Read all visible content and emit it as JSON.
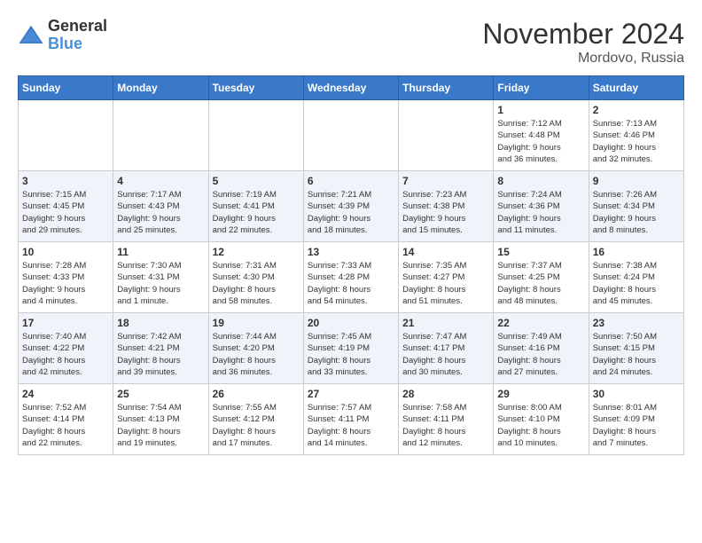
{
  "header": {
    "logo_line1": "General",
    "logo_line2": "Blue",
    "month": "November 2024",
    "location": "Mordovo, Russia"
  },
  "days_of_week": [
    "Sunday",
    "Monday",
    "Tuesday",
    "Wednesday",
    "Thursday",
    "Friday",
    "Saturday"
  ],
  "weeks": [
    [
      {
        "day": "",
        "info": ""
      },
      {
        "day": "",
        "info": ""
      },
      {
        "day": "",
        "info": ""
      },
      {
        "day": "",
        "info": ""
      },
      {
        "day": "",
        "info": ""
      },
      {
        "day": "1",
        "info": "Sunrise: 7:12 AM\nSunset: 4:48 PM\nDaylight: 9 hours\nand 36 minutes."
      },
      {
        "day": "2",
        "info": "Sunrise: 7:13 AM\nSunset: 4:46 PM\nDaylight: 9 hours\nand 32 minutes."
      }
    ],
    [
      {
        "day": "3",
        "info": "Sunrise: 7:15 AM\nSunset: 4:45 PM\nDaylight: 9 hours\nand 29 minutes."
      },
      {
        "day": "4",
        "info": "Sunrise: 7:17 AM\nSunset: 4:43 PM\nDaylight: 9 hours\nand 25 minutes."
      },
      {
        "day": "5",
        "info": "Sunrise: 7:19 AM\nSunset: 4:41 PM\nDaylight: 9 hours\nand 22 minutes."
      },
      {
        "day": "6",
        "info": "Sunrise: 7:21 AM\nSunset: 4:39 PM\nDaylight: 9 hours\nand 18 minutes."
      },
      {
        "day": "7",
        "info": "Sunrise: 7:23 AM\nSunset: 4:38 PM\nDaylight: 9 hours\nand 15 minutes."
      },
      {
        "day": "8",
        "info": "Sunrise: 7:24 AM\nSunset: 4:36 PM\nDaylight: 9 hours\nand 11 minutes."
      },
      {
        "day": "9",
        "info": "Sunrise: 7:26 AM\nSunset: 4:34 PM\nDaylight: 9 hours\nand 8 minutes."
      }
    ],
    [
      {
        "day": "10",
        "info": "Sunrise: 7:28 AM\nSunset: 4:33 PM\nDaylight: 9 hours\nand 4 minutes."
      },
      {
        "day": "11",
        "info": "Sunrise: 7:30 AM\nSunset: 4:31 PM\nDaylight: 9 hours\nand 1 minute."
      },
      {
        "day": "12",
        "info": "Sunrise: 7:31 AM\nSunset: 4:30 PM\nDaylight: 8 hours\nand 58 minutes."
      },
      {
        "day": "13",
        "info": "Sunrise: 7:33 AM\nSunset: 4:28 PM\nDaylight: 8 hours\nand 54 minutes."
      },
      {
        "day": "14",
        "info": "Sunrise: 7:35 AM\nSunset: 4:27 PM\nDaylight: 8 hours\nand 51 minutes."
      },
      {
        "day": "15",
        "info": "Sunrise: 7:37 AM\nSunset: 4:25 PM\nDaylight: 8 hours\nand 48 minutes."
      },
      {
        "day": "16",
        "info": "Sunrise: 7:38 AM\nSunset: 4:24 PM\nDaylight: 8 hours\nand 45 minutes."
      }
    ],
    [
      {
        "day": "17",
        "info": "Sunrise: 7:40 AM\nSunset: 4:22 PM\nDaylight: 8 hours\nand 42 minutes."
      },
      {
        "day": "18",
        "info": "Sunrise: 7:42 AM\nSunset: 4:21 PM\nDaylight: 8 hours\nand 39 minutes."
      },
      {
        "day": "19",
        "info": "Sunrise: 7:44 AM\nSunset: 4:20 PM\nDaylight: 8 hours\nand 36 minutes."
      },
      {
        "day": "20",
        "info": "Sunrise: 7:45 AM\nSunset: 4:19 PM\nDaylight: 8 hours\nand 33 minutes."
      },
      {
        "day": "21",
        "info": "Sunrise: 7:47 AM\nSunset: 4:17 PM\nDaylight: 8 hours\nand 30 minutes."
      },
      {
        "day": "22",
        "info": "Sunrise: 7:49 AM\nSunset: 4:16 PM\nDaylight: 8 hours\nand 27 minutes."
      },
      {
        "day": "23",
        "info": "Sunrise: 7:50 AM\nSunset: 4:15 PM\nDaylight: 8 hours\nand 24 minutes."
      }
    ],
    [
      {
        "day": "24",
        "info": "Sunrise: 7:52 AM\nSunset: 4:14 PM\nDaylight: 8 hours\nand 22 minutes."
      },
      {
        "day": "25",
        "info": "Sunrise: 7:54 AM\nSunset: 4:13 PM\nDaylight: 8 hours\nand 19 minutes."
      },
      {
        "day": "26",
        "info": "Sunrise: 7:55 AM\nSunset: 4:12 PM\nDaylight: 8 hours\nand 17 minutes."
      },
      {
        "day": "27",
        "info": "Sunrise: 7:57 AM\nSunset: 4:11 PM\nDaylight: 8 hours\nand 14 minutes."
      },
      {
        "day": "28",
        "info": "Sunrise: 7:58 AM\nSunset: 4:11 PM\nDaylight: 8 hours\nand 12 minutes."
      },
      {
        "day": "29",
        "info": "Sunrise: 8:00 AM\nSunset: 4:10 PM\nDaylight: 8 hours\nand 10 minutes."
      },
      {
        "day": "30",
        "info": "Sunrise: 8:01 AM\nSunset: 4:09 PM\nDaylight: 8 hours\nand 7 minutes."
      }
    ]
  ]
}
